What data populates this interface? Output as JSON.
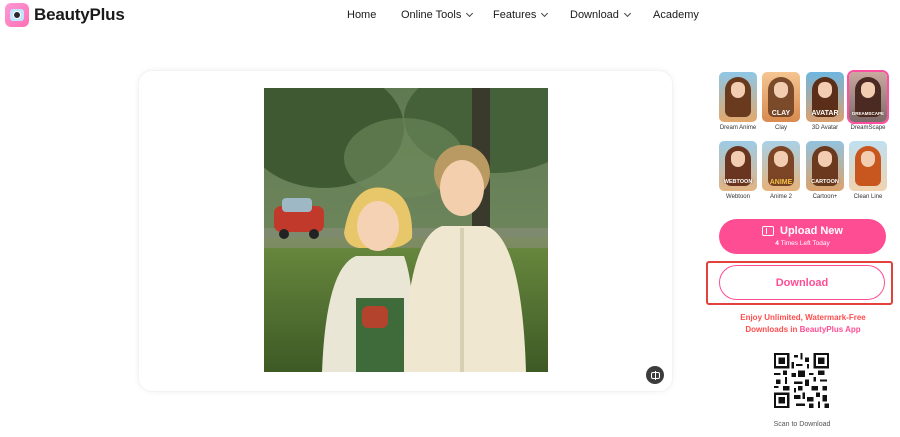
{
  "brand": {
    "name": "BeautyPlus",
    "accent": "#ff4d94"
  },
  "nav": [
    {
      "label": "Home",
      "dropdown": false
    },
    {
      "label": "Online Tools",
      "dropdown": true
    },
    {
      "label": "Features",
      "dropdown": true
    },
    {
      "label": "Download",
      "dropdown": true
    },
    {
      "label": "Academy",
      "dropdown": false
    }
  ],
  "styles": [
    {
      "label": "Dream Anime",
      "caption": "",
      "selected": false
    },
    {
      "label": "Clay",
      "caption": "CLAY",
      "selected": false
    },
    {
      "label": "3D Avatar",
      "caption": "AVATAR",
      "selected": false
    },
    {
      "label": "DreamScape",
      "caption": "DREAMSCAPE",
      "selected": true
    },
    {
      "label": "Webtoon",
      "caption": "WEBTOON",
      "selected": false
    },
    {
      "label": "Anime 2",
      "caption": "ANIME",
      "selected": false
    },
    {
      "label": "Cartoon+",
      "caption": "CARTOON",
      "selected": false
    },
    {
      "label": "Clean Line",
      "caption": "",
      "selected": false
    }
  ],
  "upload": {
    "label": "Upload New",
    "count": "4",
    "sub": "Times Left Today"
  },
  "download": {
    "label": "Download"
  },
  "promo": {
    "line1": "Enjoy Unlimited, Watermark-Free",
    "line2_prefix": "Downloads in",
    "line2_brand": "BeautyPlus App"
  },
  "qr": {
    "caption": "Scan to Download"
  },
  "icons": {
    "logo": "beautyplus-logo-icon",
    "compare": "compare-icon",
    "upload": "upload-folder-icon",
    "chevron": "chevron-down-icon"
  }
}
